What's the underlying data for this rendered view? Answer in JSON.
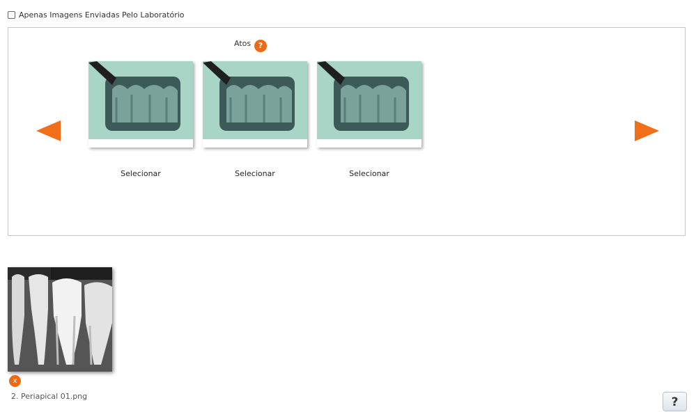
{
  "filter": {
    "label": "Apenas Imagens Enviadas Pelo Laboratório",
    "checked": false
  },
  "gallery": {
    "section_title": "Atos",
    "help_label": "?",
    "items": [
      {
        "select_label": "Selecionar"
      },
      {
        "select_label": "Selecionar"
      },
      {
        "select_label": "Selecionar"
      }
    ]
  },
  "uploaded": {
    "remove_label": "x",
    "file_name": "2. Periapical 01.png"
  },
  "help_corner": {
    "label": "?"
  },
  "colors": {
    "accent": "#f26f1a"
  }
}
